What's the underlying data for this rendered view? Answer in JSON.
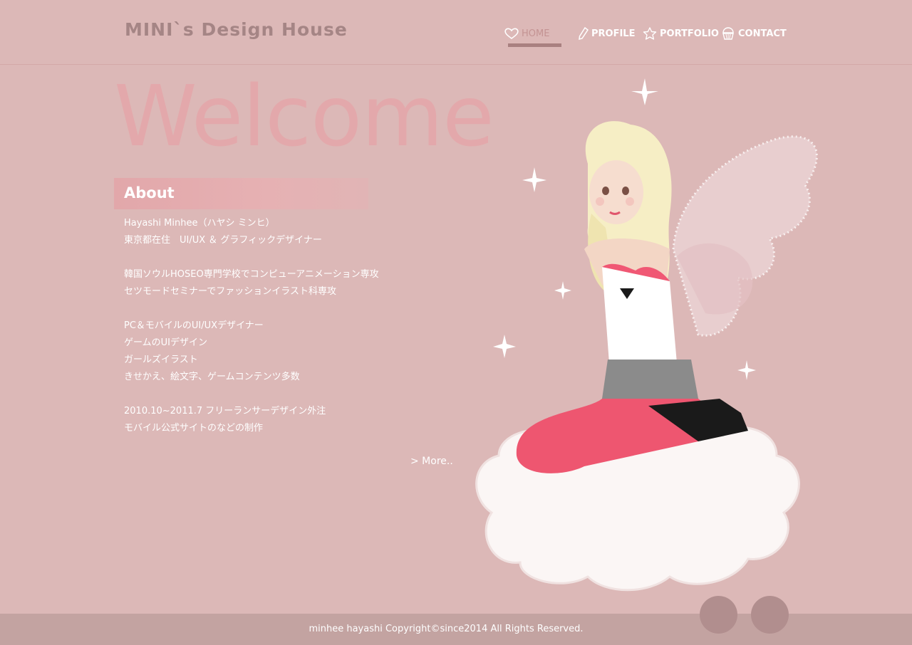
{
  "site": {
    "logo": "MINI`s Design House"
  },
  "nav": [
    {
      "label": "HOME",
      "icon": "heart-icon",
      "active": true
    },
    {
      "label": "PROFILE",
      "icon": "pencil-icon",
      "active": false
    },
    {
      "label": "PORTFOLIO",
      "icon": "star-icon",
      "active": false
    },
    {
      "label": "CONTACT",
      "icon": "cupcake-icon",
      "active": false
    }
  ],
  "hero": {
    "heading": "Welcome"
  },
  "about": {
    "title": "About",
    "lines": [
      "Hayashi Minhee（ハヤシ ミンヒ）",
      "東京都在住　UI/UX ＆ グラフィックデザイナー",
      "",
      "韓国ソウルHOSEO専門学校でコンピューアニメーション専攻",
      "セツモードセミナーでファッションイラスト科専攻",
      "",
      "PC＆モバイルのUI/UXデザイナー",
      "ゲームのUIデザイン",
      "ガールズイラスト",
      "きせかえ、絵文字、ゲームコンテンツ多数",
      "",
      "2010.10~2011.7 フリーランサーデザイン外注",
      "モバイル公式サイトのなどの制作"
    ],
    "more_label": "> More.."
  },
  "footer": {
    "copyright": "minhee hayashi Copyright©since2014 All Rights Reserved."
  },
  "colors": {
    "background": "#dcb8b7",
    "footer": "#c3a3a1",
    "accent": "#a98080",
    "welcome_text": "#e5a6a9"
  }
}
